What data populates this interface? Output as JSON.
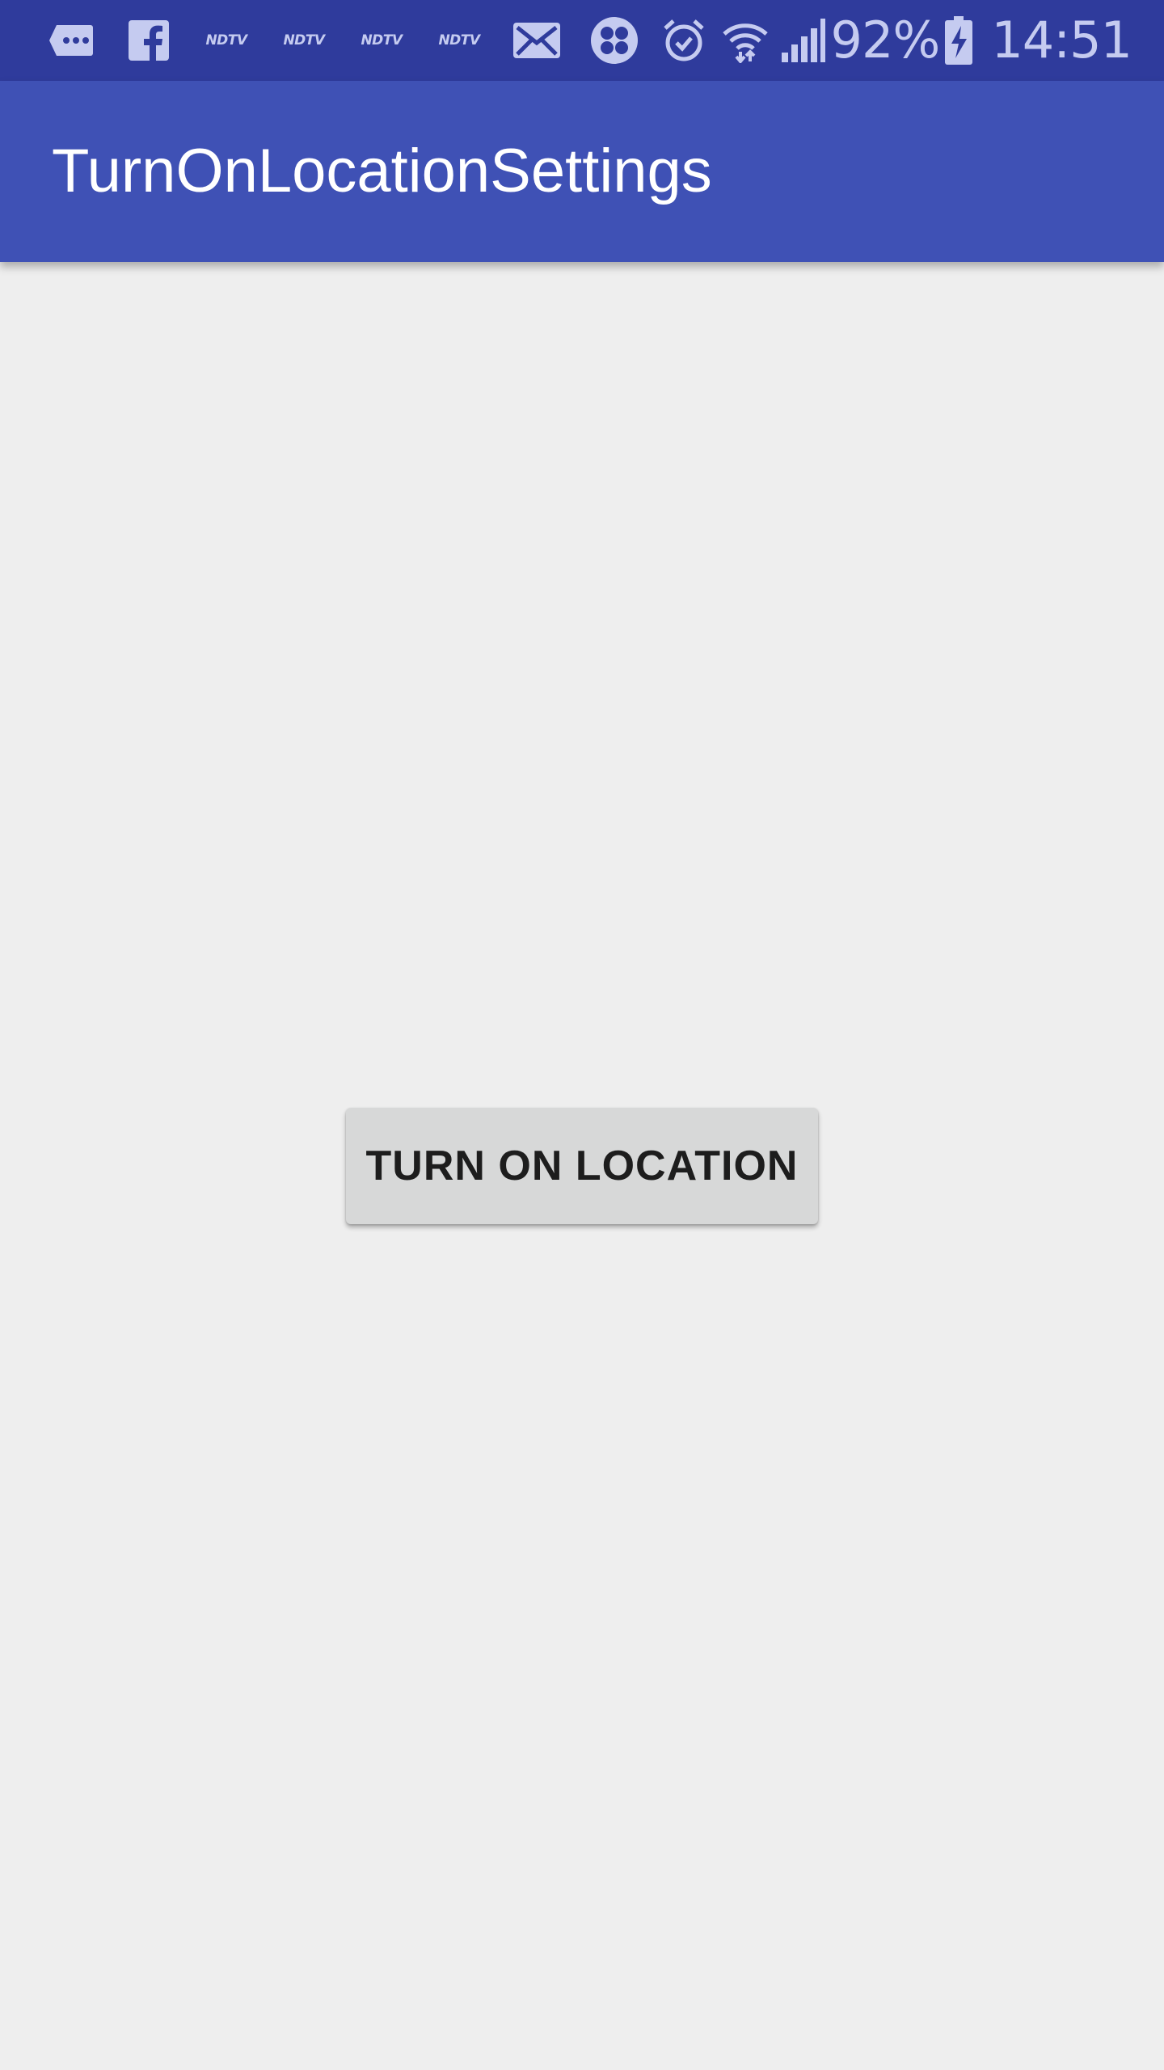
{
  "status_bar": {
    "notification_icons": [
      "chat-bubble-icon",
      "facebook-icon",
      "ndtv-icon",
      "ndtv-icon",
      "ndtv-icon",
      "ndtv-icon",
      "mail-icon",
      "pinwheel-icon"
    ],
    "ndtv_label": "NDTV",
    "system_icons": [
      "alarm-icon",
      "wifi-icon",
      "signal-icon",
      "battery-charging-icon"
    ],
    "battery_percent": "92%",
    "time": "14:51"
  },
  "app_bar": {
    "title": "TurnOnLocationSettings",
    "color": "#3f51b5"
  },
  "main": {
    "button_label": "TURN ON LOCATION"
  },
  "colors": {
    "status_bar": "#2f3b9c",
    "app_bar": "#3f51b5",
    "background": "#eeeeee",
    "button": "#d7d8d8"
  }
}
